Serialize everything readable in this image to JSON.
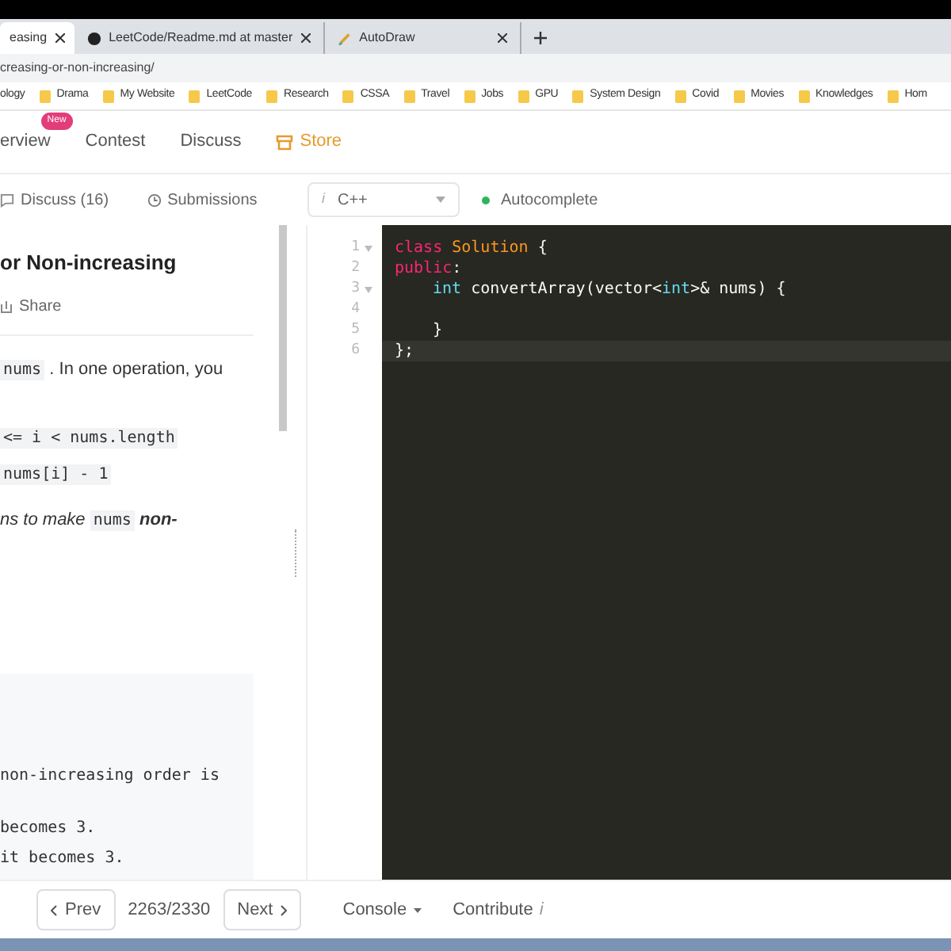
{
  "browser": {
    "tabs": [
      {
        "title": "easing",
        "selected": true
      },
      {
        "title": "LeetCode/Readme.md at master",
        "selected": false
      },
      {
        "title": "AutoDraw",
        "selected": false
      }
    ],
    "url": "creasing-or-non-increasing/",
    "bookmarks": [
      "ology",
      "Drama",
      "My Website",
      "LeetCode",
      "Research",
      "CSSA",
      "Travel",
      "Jobs",
      "GPU",
      "System Design",
      "Covid",
      "Movies",
      "Knowledges",
      "Hom"
    ]
  },
  "nav": {
    "items": [
      {
        "label": "erview",
        "badge": "New",
        "kind": "link"
      },
      {
        "label": "Contest",
        "kind": "link"
      },
      {
        "label": "Discuss",
        "kind": "link"
      },
      {
        "label": "Store",
        "kind": "store"
      }
    ]
  },
  "toolbar": {
    "discuss": "Discuss (16)",
    "submissions": "Submissions",
    "language_hint": "i",
    "language": "C++",
    "autocomplete": "Autocomplete"
  },
  "problem": {
    "title": "or Non-increasing",
    "share": "Share",
    "paragraphs": [
      [
        {
          "kind": "code",
          "text": "nums"
        },
        {
          "kind": "text",
          "text": " . In one operation, you"
        }
      ],
      [
        {
          "kind": "code",
          "text": "<= i < nums.length"
        }
      ],
      [
        {
          "kind": "code",
          "text": "nums[i] - 1"
        }
      ],
      [
        {
          "kind": "em",
          "text": "ns to make "
        },
        {
          "kind": "code",
          "text": "nums"
        },
        {
          "kind": "strong",
          "text": " non-"
        }
      ]
    ],
    "example_lines": [
      "non-increasing order is",
      "becomes 3.",
      "it becomes 3."
    ]
  },
  "editor": {
    "lines": [
      {
        "number": "1",
        "fold": true,
        "tokens": [
          {
            "kind": "keyword",
            "text": "class "
          },
          {
            "kind": "class",
            "text": "Solution"
          },
          {
            "kind": "plain",
            "text": " {"
          }
        ]
      },
      {
        "number": "2",
        "fold": false,
        "tokens": [
          {
            "kind": "keyword",
            "text": "public"
          },
          {
            "kind": "plain",
            "text": ":"
          }
        ]
      },
      {
        "number": "3",
        "fold": true,
        "indented": true,
        "tokens": [
          {
            "kind": "type",
            "text": "int"
          },
          {
            "kind": "plain",
            "text": " convertArray(vector<"
          },
          {
            "kind": "type",
            "text": "int"
          },
          {
            "kind": "plain",
            "text": ">& nums) {"
          }
        ]
      },
      {
        "number": "4",
        "fold": false
      },
      {
        "number": "5",
        "fold": false,
        "indented": true,
        "tokens": [
          {
            "kind": "plain",
            "text": "}"
          }
        ]
      },
      {
        "number": "6",
        "fold": false,
        "active": true,
        "tokens": [
          {
            "kind": "plain",
            "text": "};"
          }
        ]
      }
    ]
  },
  "footer": {
    "prev": "Prev",
    "counter": "2263/2330",
    "next": "Next",
    "console": "Console",
    "contribute": "Contribute",
    "info": "i"
  }
}
